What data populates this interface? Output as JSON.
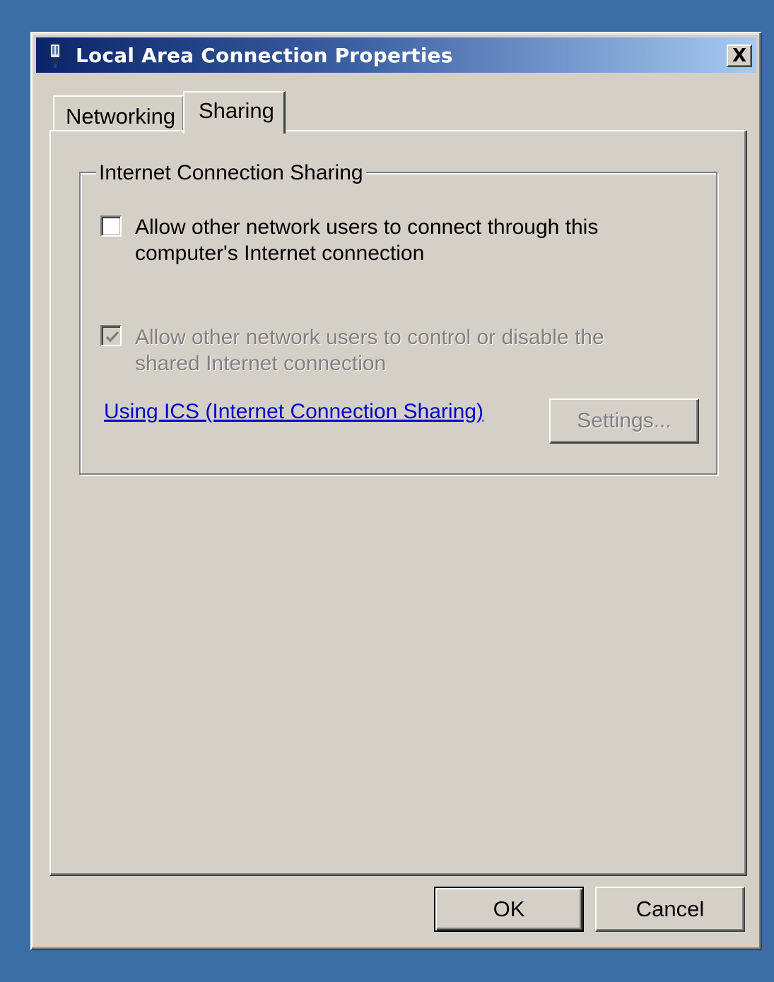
{
  "window": {
    "title": "Local Area Connection Properties",
    "close_label": "X",
    "titlebar_colors": [
      "#0a246a",
      "#a6caf0"
    ],
    "title_icon": "network-adapter-icon"
  },
  "tabs": [
    {
      "label": "Networking",
      "active": false
    },
    {
      "label": "Sharing",
      "active": true
    }
  ],
  "ics_group": {
    "legend": "Internet Connection Sharing",
    "allow_connect": {
      "line1": "Allow other network users to connect through this",
      "line2": "computer's Internet connection",
      "checked": false,
      "enabled": true
    },
    "allow_control": {
      "line1": "Allow other network users to control or disable the",
      "line2": "shared Internet connection",
      "checked": true,
      "enabled": false
    },
    "help_link": "Using ICS (Internet Connection Sharing)",
    "settings_label": "Settings...",
    "settings_enabled": false
  },
  "buttons": {
    "ok": "OK",
    "cancel": "Cancel"
  }
}
